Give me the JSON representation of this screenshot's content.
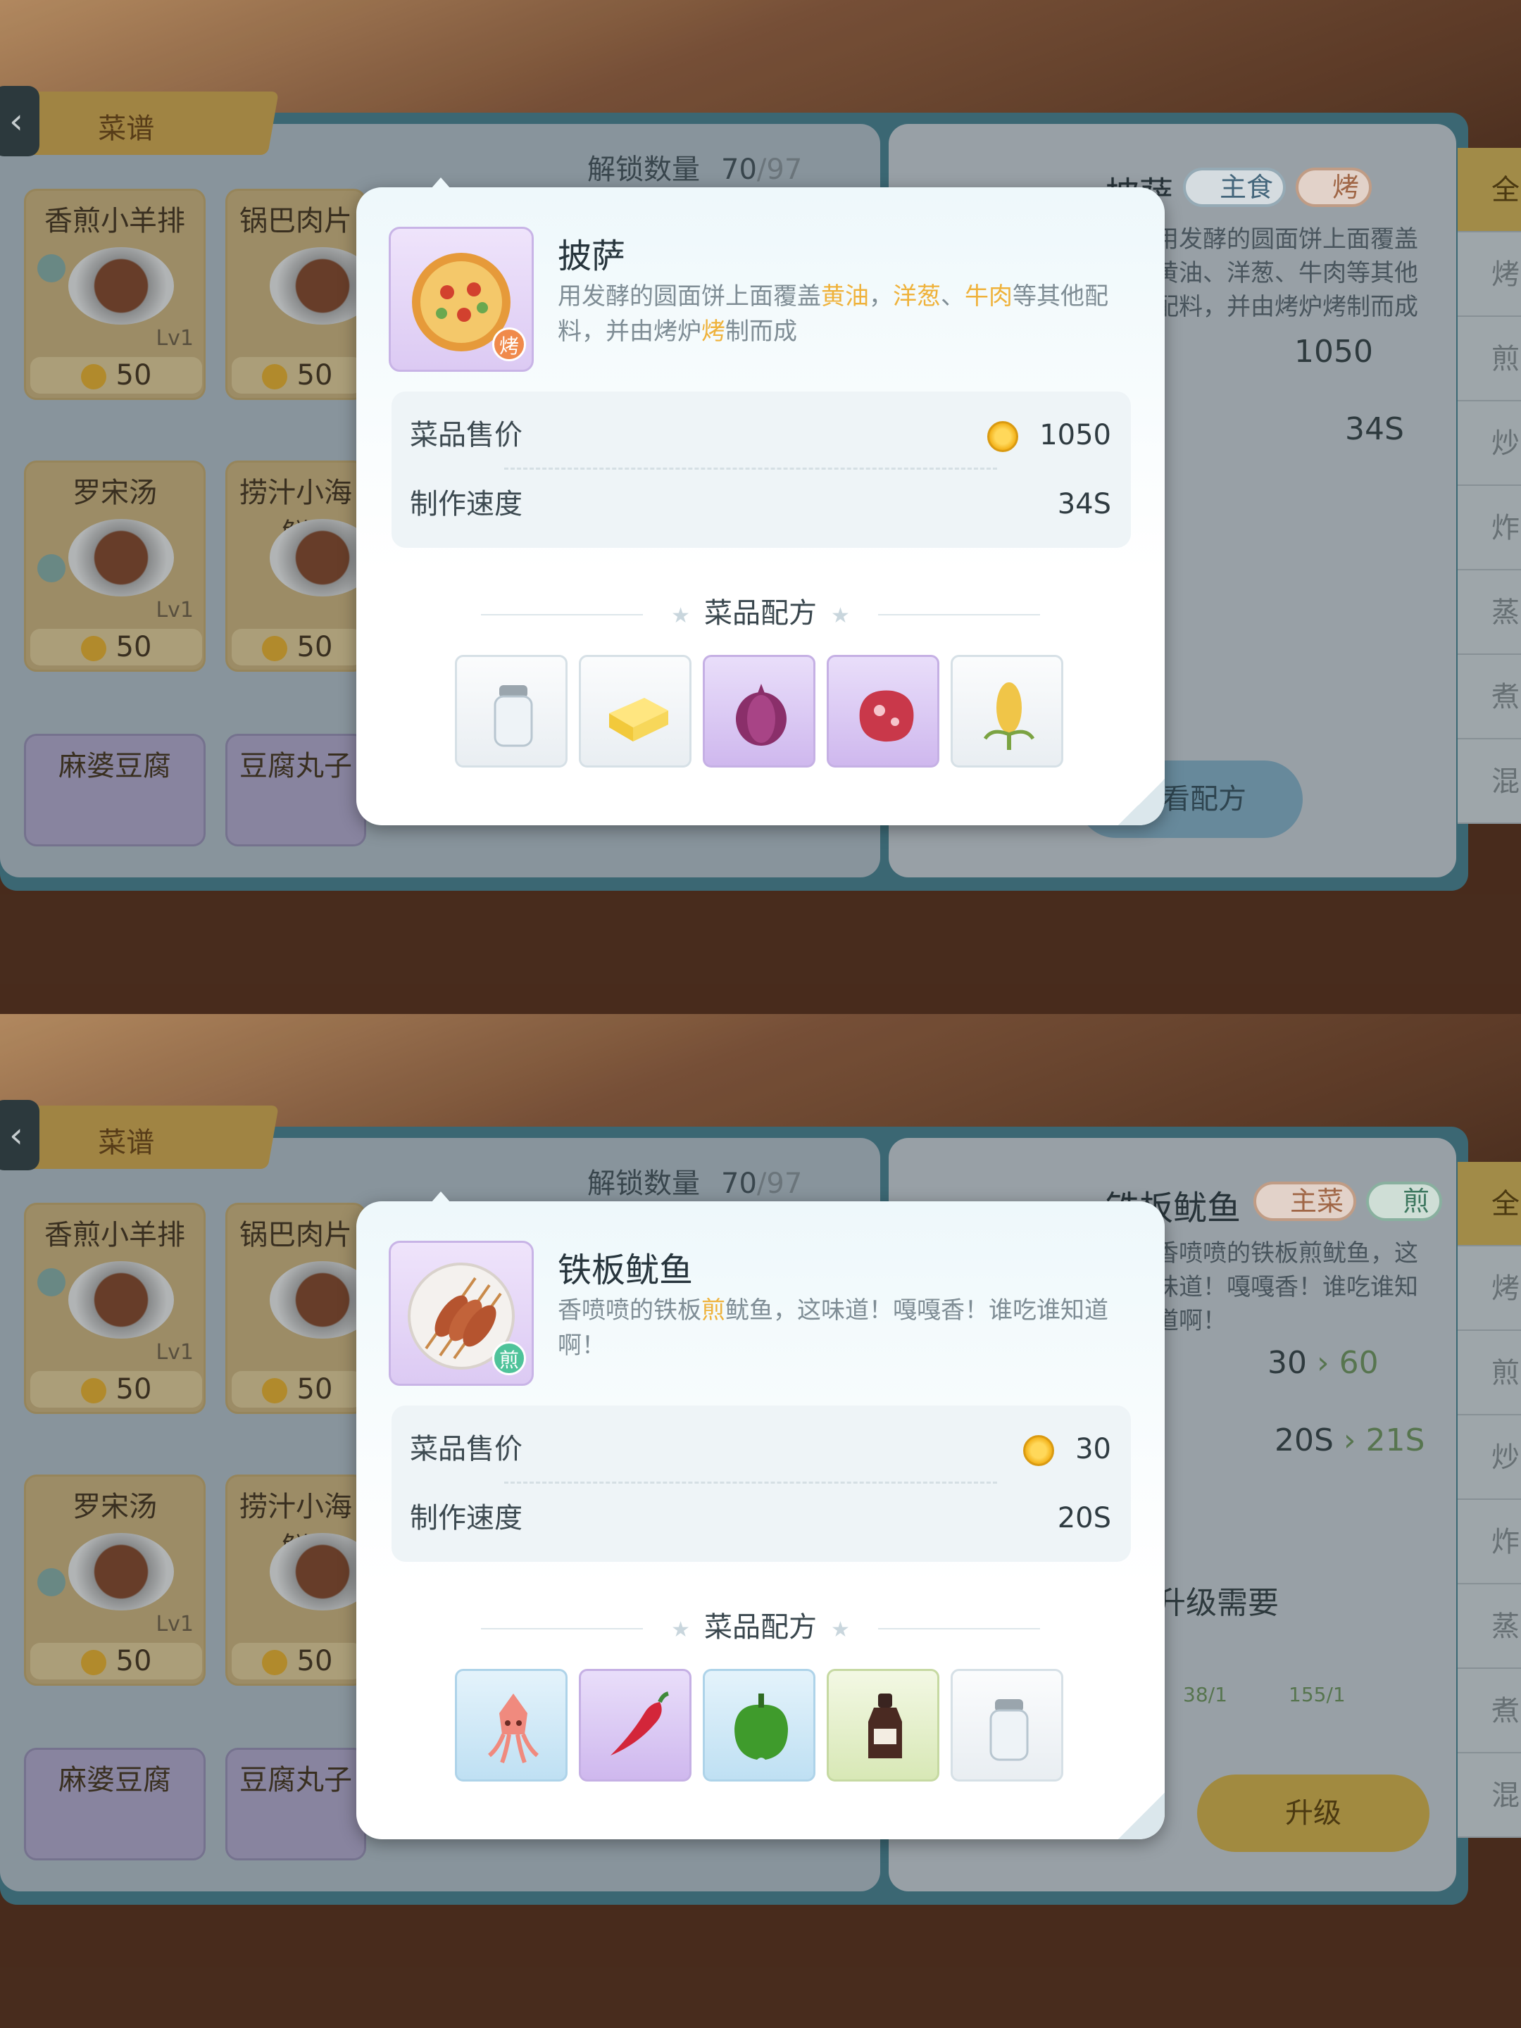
{
  "screens": [
    {
      "background": {
        "title": "菜谱",
        "unlock_label": "解锁数量",
        "unlock_current": "70",
        "unlock_total": "/97",
        "cards": [
          {
            "name": "香煎小羊排",
            "level": "Lv1",
            "price": "50"
          },
          {
            "name": "锅巴肉片",
            "price": "50"
          },
          {
            "name": "罗宋汤",
            "level": "Lv1",
            "price": "50"
          },
          {
            "name": "捞汁小海鲜",
            "price": "50"
          },
          {
            "name": "麻婆豆腐"
          },
          {
            "name": "豆腐丸子"
          }
        ],
        "right": {
          "dish_name": "披萨",
          "tag1": "主食",
          "tag2": "烤",
          "desc": "用发酵的圆面饼上面覆盖黄油、洋葱、牛肉等其他配料，并由烤炉烤制而成",
          "price": "1050",
          "speed": "34S",
          "button": "查看配方"
        },
        "side_tabs": [
          "全",
          "烤",
          "煎",
          "炒",
          "炸",
          "蒸",
          "煮",
          "混"
        ]
      },
      "popup": {
        "name": "披萨",
        "cook_method": "烤",
        "desc_parts": [
          {
            "t": "用发酵的圆面饼上面覆盖",
            "h": false
          },
          {
            "t": "黄油",
            "h": true
          },
          {
            "t": "，",
            "h": false
          },
          {
            "t": "洋葱",
            "h": true
          },
          {
            "t": "、",
            "h": false
          },
          {
            "t": "牛肉",
            "h": true
          },
          {
            "t": "等其他配料，并由烤炉",
            "h": false
          },
          {
            "t": "烤",
            "h": true
          },
          {
            "t": "制而成",
            "h": false
          }
        ],
        "price_label": "菜品售价",
        "price": "1050",
        "speed_label": "制作速度",
        "speed": "34S",
        "recipe_label": "菜品配方",
        "ingredients": [
          {
            "name": "salt-shaker",
            "bg": "gray"
          },
          {
            "name": "butter",
            "bg": "gray"
          },
          {
            "name": "onion",
            "bg": "purple"
          },
          {
            "name": "beef",
            "bg": "purple"
          },
          {
            "name": "wheat",
            "bg": "gray"
          }
        ],
        "badge_color": "#f08a4b"
      }
    },
    {
      "background": {
        "title": "菜谱",
        "unlock_label": "解锁数量",
        "unlock_current": "70",
        "unlock_total": "/97",
        "cards": [
          {
            "name": "香煎小羊排",
            "level": "Lv1",
            "price": "50"
          },
          {
            "name": "锅巴肉片",
            "price": "50"
          },
          {
            "name": "罗宋汤",
            "level": "Lv1",
            "price": "50"
          },
          {
            "name": "捞汁小海鲜",
            "price": "50"
          },
          {
            "name": "麻婆豆腐"
          },
          {
            "name": "豆腐丸子"
          }
        ],
        "right": {
          "dish_name": "铁板鱿鱼",
          "tag1": "主菜",
          "tag2": "煎",
          "desc": "香喷喷的铁板煎鱿鱼，这味道！嘎嘎香！谁吃谁知道啊！",
          "price": "30",
          "price_up": "60",
          "speed": "20S",
          "speed_up": "21S",
          "upgrade_need": "升级需要",
          "req1": "38/1",
          "req2": "155/1",
          "button": "升级"
        },
        "side_tabs": [
          "全",
          "烤",
          "煎",
          "炒",
          "炸",
          "蒸",
          "煮",
          "混"
        ]
      },
      "popup": {
        "name": "铁板鱿鱼",
        "cook_method": "煎",
        "desc_parts": [
          {
            "t": "香喷喷的铁板",
            "h": false
          },
          {
            "t": "煎",
            "h": true
          },
          {
            "t": "鱿鱼，这味道！嘎嘎香！谁吃谁知道啊！",
            "h": false
          }
        ],
        "price_label": "菜品售价",
        "price": "30",
        "speed_label": "制作速度",
        "speed": "20S",
        "recipe_label": "菜品配方",
        "ingredients": [
          {
            "name": "squid",
            "bg": "blue"
          },
          {
            "name": "chili-pepper",
            "bg": "purple"
          },
          {
            "name": "green-pepper",
            "bg": "blue"
          },
          {
            "name": "soy-sauce",
            "bg": "green"
          },
          {
            "name": "salt-shaker",
            "bg": "gray"
          }
        ],
        "badge_color": "#4fc39a"
      }
    }
  ]
}
